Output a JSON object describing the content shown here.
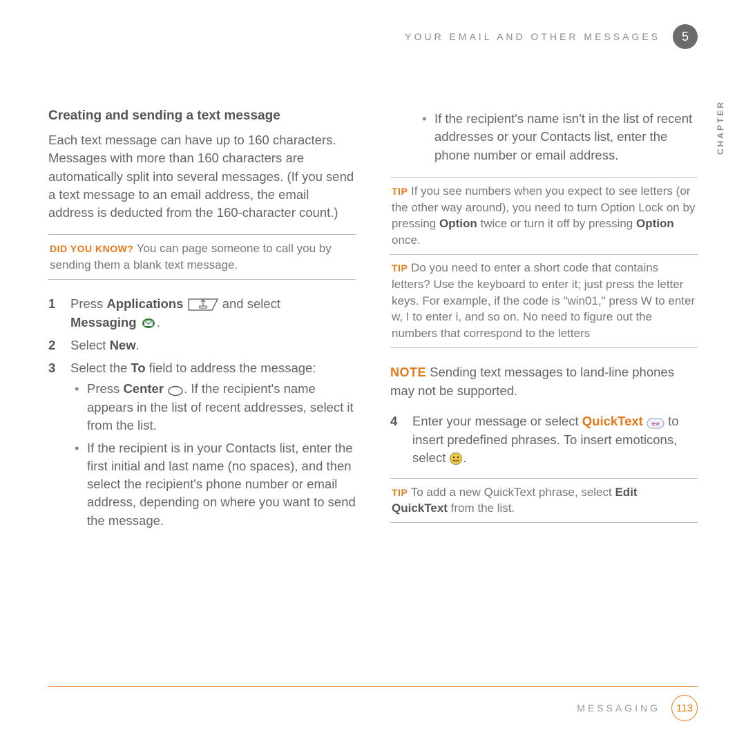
{
  "header": {
    "title": "YOUR EMAIL AND OTHER MESSAGES",
    "chapter_num": "5",
    "chapter_label": "CHAPTER"
  },
  "left": {
    "section_title": "Creating and sending a text message",
    "intro": "Each text message can have up to 160 characters. Messages with more than 160 characters are automatically split into several messages. (If you send a text message to an email address, the email address is deducted from the 160-character count.)",
    "dyk": {
      "label": "DID YOU KNOW?",
      "text": " You can page someone to call you by sending them a blank text message."
    },
    "steps": {
      "s1_num": "1",
      "s1_a": "Press ",
      "s1_b": "Applications",
      "s1_c": " and select ",
      "s1_d": "Messaging",
      "s1_e": ".",
      "s2_num": "2",
      "s2_a": "Select ",
      "s2_b": "New",
      "s2_c": ".",
      "s3_num": "3",
      "s3_a": "Select the ",
      "s3_b": "To",
      "s3_c": " field to address the message:",
      "b1_a": "Press ",
      "b1_b": "Center",
      "b1_c": ". If the recipient's name appears in the list of recent addresses, select it from the list.",
      "b2": "If the recipient is in your Contacts list, enter the first initial and last name (no spaces), and then select the recipient's phone number or email address, depending on where you want to send the message."
    }
  },
  "right": {
    "b3": "If the recipient's name isn't in the list of recent addresses or your Contacts list, enter the phone number or email address.",
    "tip1": {
      "label": "TIP",
      "t1": " If you see numbers when you expect to see letters (or the other way around), you need to turn Option Lock on by pressing ",
      "t2": "Option",
      "t3": " twice or turn it off by pressing ",
      "t4": "Option",
      "t5": " once."
    },
    "tip2": {
      "label": "TIP",
      "text": " Do you need to enter a short code that contains letters? Use the keyboard to enter it; just press the letter keys. For example, if the code is \"win01,\" press W to enter w, I to enter i, and so on. No need to figure out the numbers that correspond to the letters"
    },
    "note": {
      "label": "NOTE",
      "text": " Sending text messages to land-line phones may not be supported."
    },
    "s4_num": "4",
    "s4_a": "Enter your message or select ",
    "s4_b": "QuickText",
    "s4_c": " to insert predefined phrases. To insert emoticons, select ",
    "s4_d": ".",
    "tip3": {
      "label": "TIP",
      "t1": " To add a new QuickText phrase, select ",
      "t2": "Edit QuickText",
      "t3": " from the list."
    }
  },
  "footer": {
    "section": "MESSAGING",
    "page": "113"
  }
}
